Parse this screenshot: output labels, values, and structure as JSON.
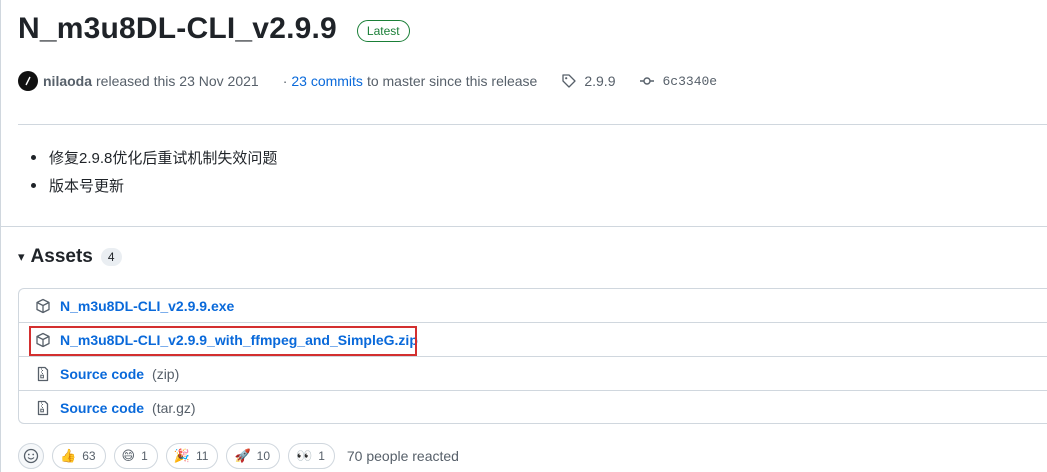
{
  "release": {
    "title": "N_m3u8DL-CLI_v2.9.9",
    "badge": "Latest"
  },
  "meta": {
    "author": "nilaoda",
    "released_text": "released this 23 Nov 2021",
    "dot": "·",
    "commits_link": "23 commits",
    "commits_suffix": "to master since this release",
    "tag": "2.9.9",
    "commit": "6c3340e"
  },
  "notes": [
    "修复2.9.8优化后重试机制失效问题",
    "版本号更新"
  ],
  "assets": {
    "caret": "▾",
    "title": "Assets",
    "count": "4",
    "items": [
      {
        "name": "N_m3u8DL-CLI_v2.9.9.exe",
        "sub": "",
        "icon": "package-icon"
      },
      {
        "name": "N_m3u8DL-CLI_v2.9.9_with_ffmpeg_and_SimpleG.zip",
        "sub": "",
        "icon": "package-icon"
      },
      {
        "name": "Source code",
        "sub": "(zip)",
        "icon": "file-zip-icon"
      },
      {
        "name": "Source code",
        "sub": "(tar.gz)",
        "icon": "file-zip-icon"
      }
    ]
  },
  "reactions": {
    "items": [
      {
        "emoji": "👍",
        "count": "63",
        "icon": "thumbs-up-icon"
      },
      {
        "emoji": "😄",
        "count": "1",
        "icon": "laugh-icon"
      },
      {
        "emoji": "🎉",
        "count": "11",
        "icon": "hooray-icon"
      },
      {
        "emoji": "🚀",
        "count": "10",
        "icon": "rocket-icon"
      },
      {
        "emoji": "👀",
        "count": "1",
        "icon": "eyes-icon"
      }
    ],
    "summary": "70 people reacted"
  },
  "colors": {
    "link": "#0969da",
    "latest": "#1a7f37",
    "highlight": "#d32f2f"
  }
}
